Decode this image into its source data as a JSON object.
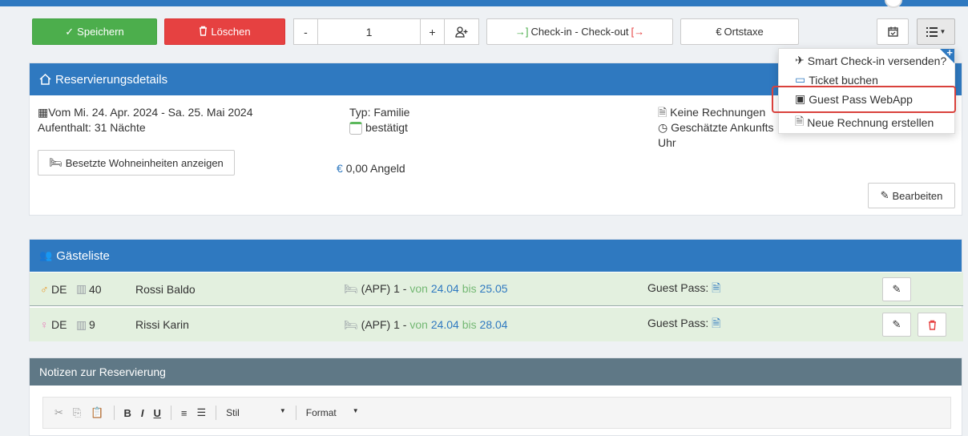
{
  "toolbar": {
    "save_label": "Speichern",
    "delete_label": "Löschen",
    "stepper_minus": "-",
    "stepper_value": "1",
    "stepper_plus": "+",
    "checkin_label": "Check-in - Check-out",
    "tax_label": "Ortstaxe",
    "tax_symbol": "€"
  },
  "details": {
    "title": "Reservierungsdetails",
    "dates": "Vom Mi. 24. Apr. 2024 - Sa. 25. Mai 2024",
    "stay": "Aufenthalt: 31 Nächte",
    "type": "Typ: Familie",
    "confirmed": "bestätigt",
    "deposit": "0,00 Angeld",
    "deposit_currency": "€",
    "invoices": "Keine Rechnungen",
    "arrival_line1": "Geschätzte Ankunfts",
    "arrival_line2": "Uhr",
    "units_button": "Besetzte Wohneinheiten anzeigen",
    "edit_button": "Bearbeiten"
  },
  "guests": {
    "title": "Gästeliste",
    "rows": [
      {
        "country": "DE",
        "age": "40",
        "name": "Rossi Baldo",
        "unit": "(APF) 1 -",
        "from_label": "von",
        "from": "24.04",
        "to_label": "bis",
        "to": "25.05",
        "pass_label": "Guest Pass:"
      },
      {
        "country": "DE",
        "age": "9",
        "name": "Rissi Karin",
        "unit": "(APF) 1 -",
        "from_label": "von",
        "from": "24.04",
        "to_label": "bis",
        "to": "28.04",
        "pass_label": "Guest Pass:"
      }
    ]
  },
  "notes": {
    "title": "Notizen zur Reservierung",
    "bold": "B",
    "italic": "I",
    "underline": "U",
    "style_label": "Stil",
    "format_label": "Format"
  },
  "menu": {
    "items": [
      {
        "label": "Smart Check-in versenden?"
      },
      {
        "label": "Ticket buchen"
      },
      {
        "label": "Guest Pass WebApp"
      },
      {
        "label": "Neue Rechnung erstellen"
      }
    ]
  },
  "colors": {
    "primary": "#2f79c0",
    "success": "#4cae4c",
    "danger": "#e64141",
    "highlight": "#d9413c"
  }
}
